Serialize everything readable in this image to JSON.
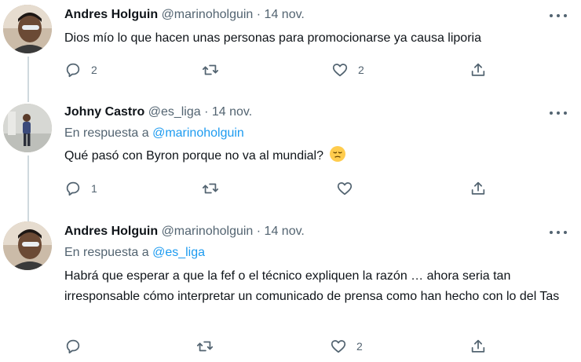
{
  "tweets": [
    {
      "author_name": "Andres Holguin",
      "handle": "@marinoholguin",
      "separator": "·",
      "date": "14 nov.",
      "reply_prefix": "",
      "reply_mention": "",
      "text": "Dios mío lo que hacen unas personas para promocionarse ya causa liporia",
      "reply_count": "2",
      "retweet_count": "",
      "like_count": "2"
    },
    {
      "author_name": "Johny Castro",
      "handle": "@es_liga",
      "separator": "·",
      "date": "14 nov.",
      "reply_prefix": "En respuesta a",
      "reply_mention": "@marinoholguin",
      "text": "Qué pasó con Byron porque no va al mundial?",
      "emoji": "pensive-face",
      "reply_count": "1",
      "retweet_count": "",
      "like_count": ""
    },
    {
      "author_name": "Andres Holguin",
      "handle": "@marinoholguin",
      "separator": "·",
      "date": "14 nov.",
      "reply_prefix": "En respuesta a",
      "reply_mention": "@es_liga",
      "text": "Habrá que esperar a que la fef o el técnico expliquen la razón … ahora seria tan irresponsable cómo interpretar un comunicado de prensa como han hecho con lo del Tas",
      "reply_count": "",
      "retweet_count": "",
      "like_count": "2"
    }
  ],
  "icons": {
    "reply": "reply-icon",
    "retweet": "retweet-icon",
    "like": "like-icon",
    "share": "share-icon",
    "more": "more-icon"
  },
  "colors": {
    "text": "#0f1419",
    "secondary": "#536471",
    "link": "#1d9bf0",
    "thread_line": "#cfd9de"
  }
}
